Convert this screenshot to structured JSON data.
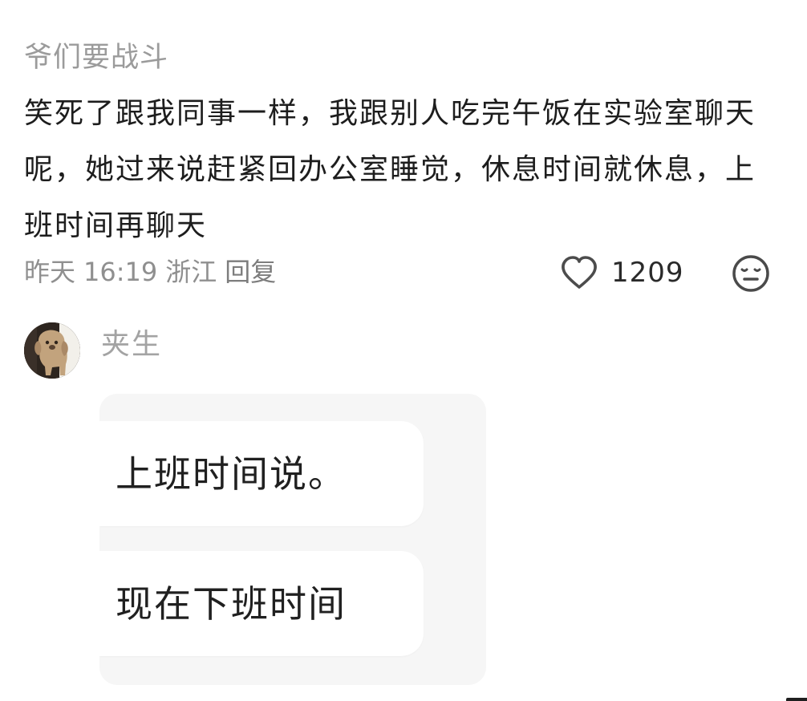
{
  "comment": {
    "author": "爷们要战斗",
    "text": "笑死了跟我同事一样，我跟别人吃完午饭在实验室聊天呢，她过来说赶紧回办公室睡觉，休息时间就休息，上班时间再聊天",
    "meta": {
      "date": "昨天",
      "time": "16:19",
      "location": "浙江",
      "reply_label": "回复"
    },
    "like": {
      "icon": "heart-icon",
      "count": "1209"
    },
    "emoji_icon": "neutral-face-icon"
  },
  "reply": {
    "author": "夹生",
    "avatar": "dog-avatar",
    "messages": [
      "上班时间说。",
      "现在下班时间"
    ]
  },
  "colors": {
    "author_text": "#9b9b9b",
    "body_text": "#1d1d1d",
    "meta_text": "#8f8f8f",
    "card_background": "#f6f6f6",
    "bubble_background": "#ffffff"
  }
}
